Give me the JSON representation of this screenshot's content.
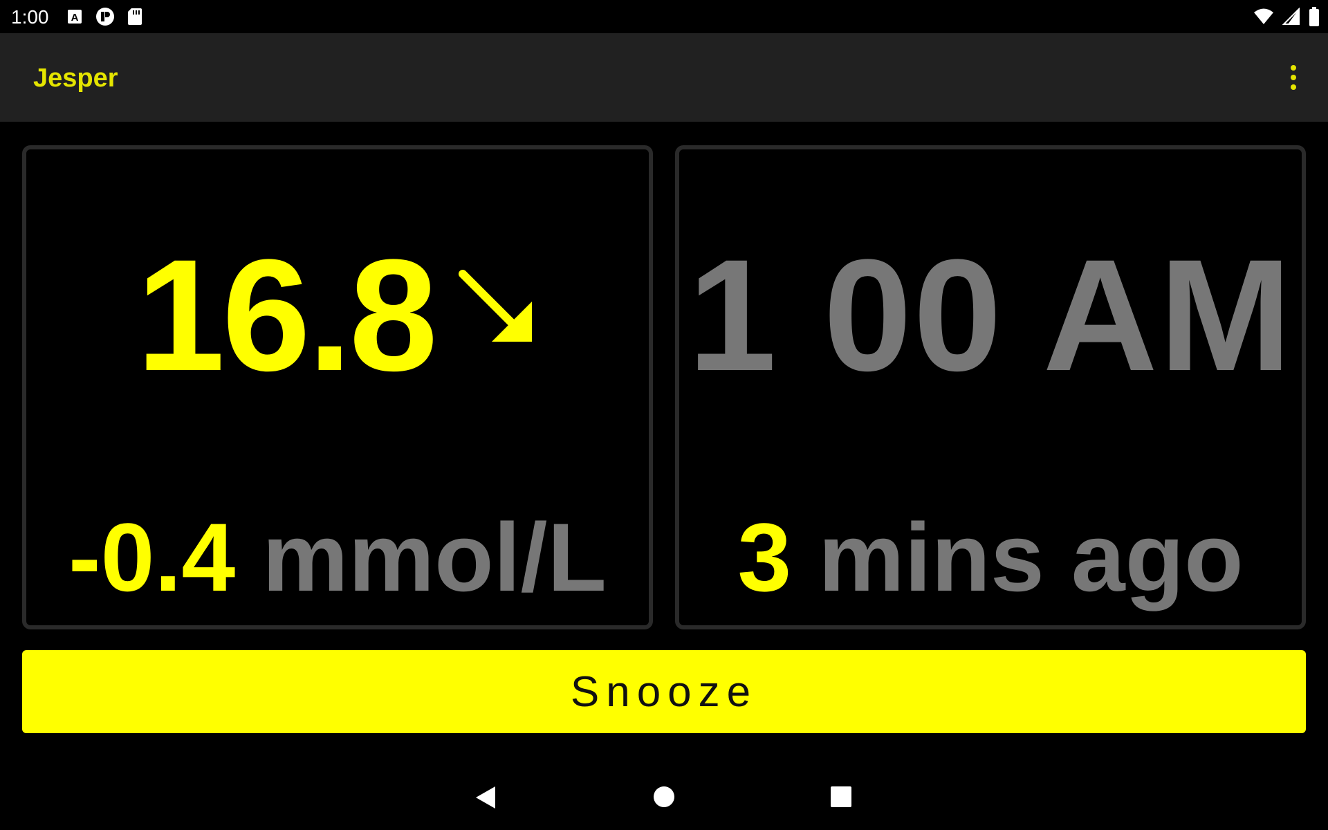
{
  "status_bar": {
    "time": "1:00",
    "left_icons": [
      "text-icon",
      "notification-icon",
      "sd-card-icon"
    ],
    "right_icons": [
      "wifi-icon",
      "signal-icon",
      "battery-icon"
    ]
  },
  "app_bar": {
    "title": "Jesper",
    "menu_icon": "more-vert-icon"
  },
  "glucose_panel": {
    "value": "16.8",
    "trend_icon": "arrow-down-right-icon",
    "delta": "-0.4",
    "unit": "mmol/L"
  },
  "time_panel": {
    "time": "1 00 AM",
    "ago_value": "3",
    "ago_label": "mins ago"
  },
  "snooze_button": {
    "label": "Snooze"
  },
  "nav_bar": {
    "icons": [
      "back-icon",
      "home-icon",
      "recents-icon"
    ]
  },
  "colors": {
    "accent": "#ffff00",
    "title": "#e5e500",
    "muted": "#777777",
    "app_bar": "#212121",
    "background": "#000000"
  }
}
